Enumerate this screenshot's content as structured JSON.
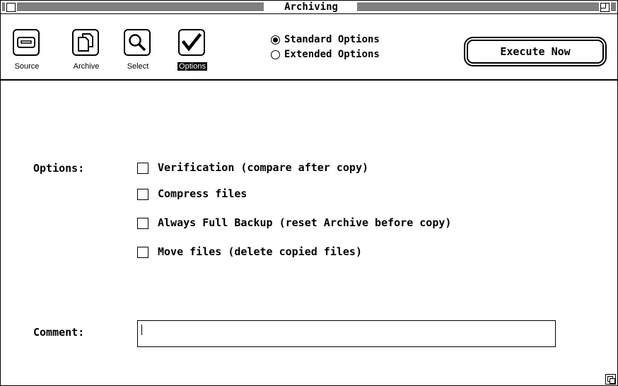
{
  "window": {
    "title": "Archiving"
  },
  "toolbar": {
    "tools": [
      {
        "label": "Source",
        "icon": "drive-icon",
        "selected": false
      },
      {
        "label": "Archive",
        "icon": "documents-icon",
        "selected": false
      },
      {
        "label": "Select",
        "icon": "magnifier-icon",
        "selected": false
      },
      {
        "label": "Options",
        "icon": "checkmark-icon",
        "selected": true
      }
    ],
    "radio_options": [
      {
        "label": "Standard Options",
        "checked": true
      },
      {
        "label": "Extended Options",
        "checked": false
      }
    ],
    "execute_label": "Execute Now"
  },
  "main": {
    "options_label": "Options:",
    "options": [
      {
        "label": "Verification (compare after copy)",
        "checked": false
      },
      {
        "label": "Compress files",
        "checked": false
      },
      {
        "label": "Always Full Backup (reset Archive before copy)",
        "checked": false
      },
      {
        "label": "Move files (delete copied files)",
        "checked": false
      }
    ],
    "comment_label": "Comment:",
    "comment_value": ""
  }
}
